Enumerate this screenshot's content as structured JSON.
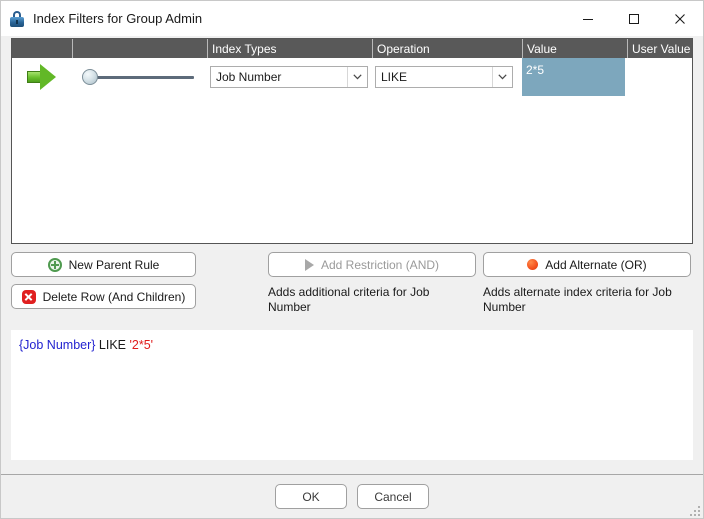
{
  "window": {
    "title": "Index Filters for Group Admin",
    "icon": "lock-icon",
    "controls": {
      "minimize": "—",
      "maximize": "□",
      "close": "✕"
    }
  },
  "grid": {
    "columns": [
      "",
      "",
      "Index Types",
      "Operation",
      "Value",
      "User Value"
    ],
    "rows": [
      {
        "marker": "green-arrow",
        "slider_value": 0,
        "index_type": "Job Number",
        "operation": "LIKE",
        "value": "2*5",
        "user_value": ""
      }
    ]
  },
  "actions": {
    "new_parent_rule": "New Parent Rule",
    "delete_row": "Delete Row (And Children)",
    "add_restriction": "Add Restriction (AND)",
    "add_restriction_hint": "Adds additional criteria for Job Number",
    "add_alternate": "Add Alternate (OR)",
    "add_alternate_hint": "Adds alternate index criteria for Job Number"
  },
  "expression": {
    "field": "{Job Number}",
    "operator": "LIKE",
    "value": "'2*5'"
  },
  "footer": {
    "ok": "OK",
    "cancel": "Cancel"
  },
  "colors": {
    "header_bg": "#595959",
    "selection": "#7da7bd",
    "field_token": "#2323d0",
    "value_token": "#e01b1b",
    "accent_green": "#62b827",
    "accent_red": "#e02020",
    "accent_orange": "#f4511e"
  }
}
